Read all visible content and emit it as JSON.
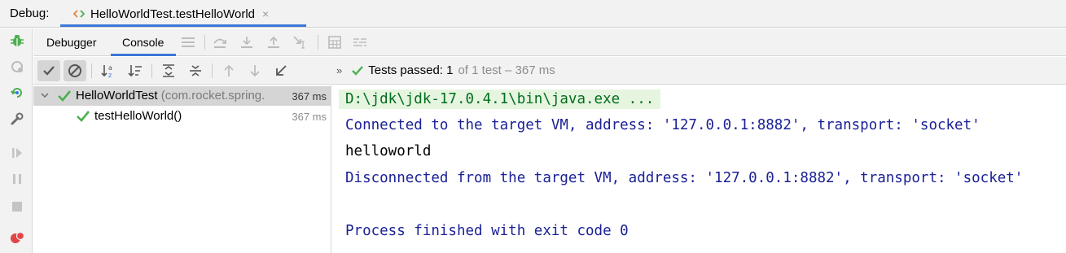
{
  "titlebar": {
    "label": "Debug:",
    "tab_title": "HelloWorldTest.testHelloWorld",
    "close_glyph": "×"
  },
  "tabs": {
    "debugger": "Debugger",
    "console": "Console"
  },
  "status": {
    "chevron": "»",
    "passed_label": "Tests passed: ",
    "passed_count": "1",
    "detail": "of 1 test – 367 ms"
  },
  "tree": {
    "root": {
      "name": "HelloWorldTest",
      "package": " (com.rocket.spring.",
      "duration": "367 ms"
    },
    "child": {
      "name": "testHelloWorld()",
      "duration": "367 ms"
    }
  },
  "console": {
    "lines": [
      "D:\\jdk\\jdk-17.0.4.1\\bin\\java.exe ...",
      "Connected to the target VM, address: '127.0.0.1:8882', transport: 'socket'",
      "helloworld",
      "Disconnected from the target VM, address: '127.0.0.1:8882', transport: 'socket'",
      "",
      "Process finished with exit code 0"
    ]
  },
  "colors": {
    "accent": "#3b78d8",
    "pass_green": "#4caf50",
    "console_system": "#1b2196",
    "console_cmd": "#006e1f"
  }
}
